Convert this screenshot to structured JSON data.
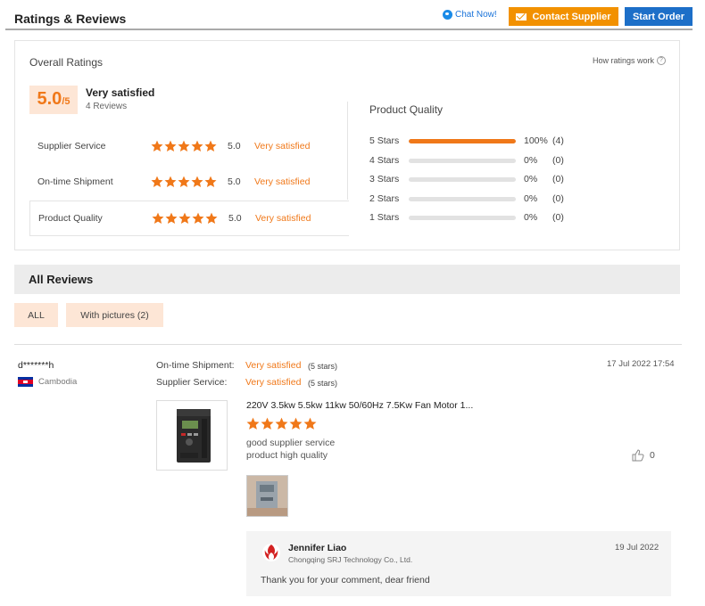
{
  "header": {
    "title": "Ratings & Reviews",
    "chat_label": "Chat Now!",
    "contact_label": "Contact Supplier",
    "start_label": "Start Order"
  },
  "overall": {
    "title": "Overall Ratings",
    "how_label": "How ratings work",
    "score": "5.0",
    "score_max": "/5",
    "satisfaction": "Very satisfied",
    "reviews_count": "4 Reviews",
    "categories": [
      {
        "label": "Supplier Service",
        "stars": 5,
        "value": "5.0",
        "satisfaction": "Very satisfied"
      },
      {
        "label": "On-time Shipment",
        "stars": 5,
        "value": "5.0",
        "satisfaction": "Very satisfied"
      },
      {
        "label": "Product Quality",
        "stars": 5,
        "value": "5.0",
        "satisfaction": "Very satisfied"
      }
    ]
  },
  "product_quality": {
    "title": "Product Quality",
    "rows": [
      {
        "label": "5 Stars",
        "fraction": 1.0,
        "percent": "100%",
        "count": "(4)"
      },
      {
        "label": "4 Stars",
        "fraction": 0,
        "percent": "0%",
        "count": "(0)"
      },
      {
        "label": "3 Stars",
        "fraction": 0,
        "percent": "0%",
        "count": "(0)"
      },
      {
        "label": "2 Stars",
        "fraction": 0,
        "percent": "0%",
        "count": "(0)"
      },
      {
        "label": "1 Stars",
        "fraction": 0,
        "percent": "0%",
        "count": "(0)"
      }
    ]
  },
  "all_reviews": {
    "title": "All Reviews",
    "filters": {
      "all": "ALL",
      "pictures": "With pictures (2)"
    }
  },
  "review": {
    "reviewer": "d*******h",
    "country": "Cambodia",
    "shipment_label": "On-time Shipment:",
    "shipment_value": "Very satisfied",
    "shipment_stars": "(5 stars)",
    "service_label": "Supplier Service:",
    "service_value": "Very satisfied",
    "service_stars": "(5 stars)",
    "date": "17 Jul 2022 17:54",
    "product_title": "220V 3.5kw 5.5kw 11kw 50/60Hz 7.5Kw Fan Motor 1...",
    "rating_stars": 5,
    "text_line1": "good supplier service",
    "text_line2": "product high quality",
    "likes": "0"
  },
  "reply": {
    "name": "Jennifer Liao",
    "company": "Chongqing SRJ Technology Co., Ltd.",
    "date": "19 Jul 2022",
    "message": "Thank you for your comment, dear friend"
  },
  "colors": {
    "accent": "#f07819",
    "contact_button": "#f29100",
    "start_button": "#1d6fc8",
    "score_bg": "#fde6d6"
  }
}
